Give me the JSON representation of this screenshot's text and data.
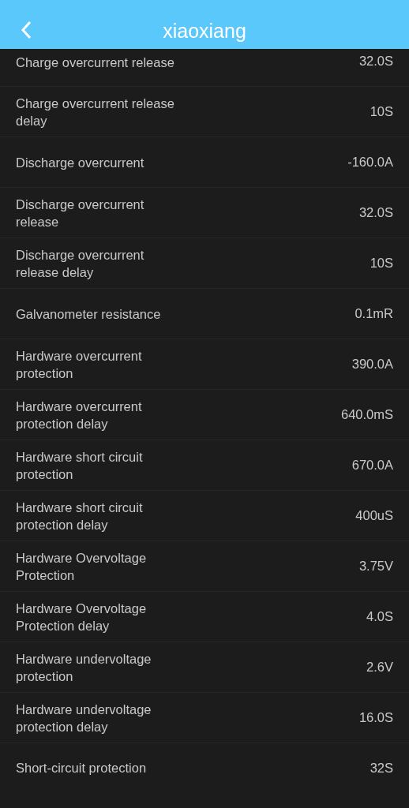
{
  "header": {
    "title": "xiaoxiang"
  },
  "rows": [
    {
      "label": "Charge overcurrent release",
      "value": "32.0S"
    },
    {
      "label": "Charge overcurrent release delay",
      "value": "10S"
    },
    {
      "label": "Discharge overcurrent",
      "value": "-160.0A"
    },
    {
      "label": "Discharge overcurrent release",
      "value": "32.0S"
    },
    {
      "label": "Discharge overcurrent release delay",
      "value": "10S"
    },
    {
      "label": "Galvanometer resistance",
      "value": "0.1mR"
    },
    {
      "label": "Hardware overcurrent protection",
      "value": "390.0A"
    },
    {
      "label": "Hardware overcurrent protection delay",
      "value": "640.0mS"
    },
    {
      "label": "Hardware short circuit protection",
      "value": "670.0A"
    },
    {
      "label": "Hardware short circuit protection delay",
      "value": "400uS"
    },
    {
      "label": "Hardware Overvoltage Protection",
      "value": "3.75V"
    },
    {
      "label": "Hardware Overvoltage Protection delay",
      "value": "4.0S"
    },
    {
      "label": "Hardware undervoltage protection",
      "value": "2.6V"
    },
    {
      "label": "Hardware undervoltage protection delay",
      "value": "16.0S"
    },
    {
      "label": "Short-circuit protection",
      "value": "32S"
    }
  ]
}
